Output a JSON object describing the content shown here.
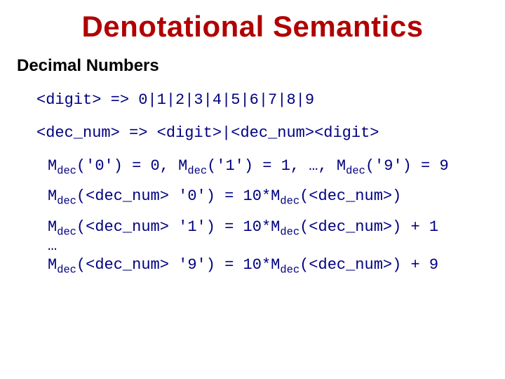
{
  "title": "Denotational Semantics",
  "subheading": "Decimal Numbers",
  "grammar": {
    "digit": "<digit> => 0|1|2|3|4|5|6|7|8|9",
    "decnum": "<dec_num> => <digit>|<dec_num><digit>"
  },
  "equations": {
    "base_l1": "('0') = 0, M",
    "base_l2": "('1') = 1, …, M",
    "base_l3": "('9') = 9",
    "rec0_l": "(<dec_num> '0') = 10*M",
    "rec0_r": "(<dec_num>)",
    "rec1_l": "(<dec_num> '1') = 10*M",
    "rec1_r": "(<dec_num>) + 1",
    "ellipsis": "…",
    "rec9_l": "(<dec_num> '9') = 10*M",
    "rec9_r": "(<dec_num>) + 9",
    "M": "M",
    "dec": "dec"
  }
}
